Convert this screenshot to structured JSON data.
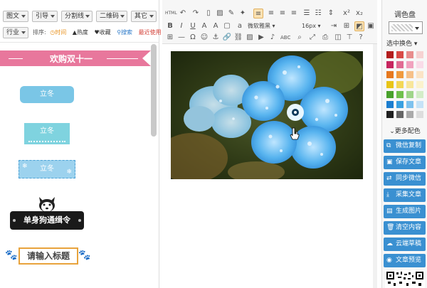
{
  "tabs": [
    {
      "label": "图文"
    },
    {
      "label": "引导"
    },
    {
      "label": "分割线"
    },
    {
      "label": "二维码"
    },
    {
      "label": "其它"
    },
    {
      "label": "行业"
    }
  ],
  "sort": {
    "label": "排序:",
    "items": [
      {
        "label": "时间",
        "color": "orange"
      },
      {
        "label": "热度",
        "color": "dark"
      },
      {
        "label": "收藏",
        "color": "dark"
      },
      {
        "label": "搜索",
        "color": "blue"
      },
      {
        "label": "最近使用",
        "color": "red"
      }
    ]
  },
  "templates": {
    "ribbon_title": "欢购双十一",
    "button_label": "立冬",
    "dog_banner": "单身狗通缉令",
    "title_placeholder": "请输入标题"
  },
  "editor": {
    "font_family": "微软雅黑",
    "font_size": "16px",
    "image_desc": "blue flower with water drops"
  },
  "palette": {
    "title": "调色盘",
    "pick_label": "选中换色",
    "more_label": "更多配色",
    "colors": [
      "#b31d1d",
      "#d84a46",
      "#e88d8d",
      "#f6d2d2",
      "#c7265f",
      "#e16c93",
      "#f1a2be",
      "#f9dce8",
      "#e6781e",
      "#f09a3e",
      "#f6c088",
      "#fbe4c6",
      "#e8c417",
      "#f3d756",
      "#f8e69a",
      "#fbf2cd",
      "#48a12b",
      "#6fc04c",
      "#9fd58a",
      "#d3edc8",
      "#1c7ecf",
      "#3aa0e0",
      "#7ec2ee",
      "#c6e3f7",
      "#1f1f1f",
      "#666666",
      "#aaaaaa",
      "#dddddd"
    ]
  },
  "actions": [
    {
      "label": "微信复制",
      "icon": "copy-icon",
      "glyph": "⧉"
    },
    {
      "label": "保存文章",
      "icon": "save-icon",
      "glyph": "▣"
    },
    {
      "label": "同步微信",
      "icon": "sync-icon",
      "glyph": "⇄"
    },
    {
      "label": "采集文章",
      "icon": "collect-icon",
      "glyph": "⤓"
    },
    {
      "label": "生成图片",
      "icon": "image-icon",
      "glyph": "▤"
    },
    {
      "label": "清空内容",
      "icon": "trash-icon",
      "glyph": "🗑"
    },
    {
      "label": "云端草稿",
      "icon": "cloud-icon",
      "glyph": "☁"
    },
    {
      "label": "文章预览",
      "icon": "eye-icon",
      "glyph": "◉"
    }
  ]
}
